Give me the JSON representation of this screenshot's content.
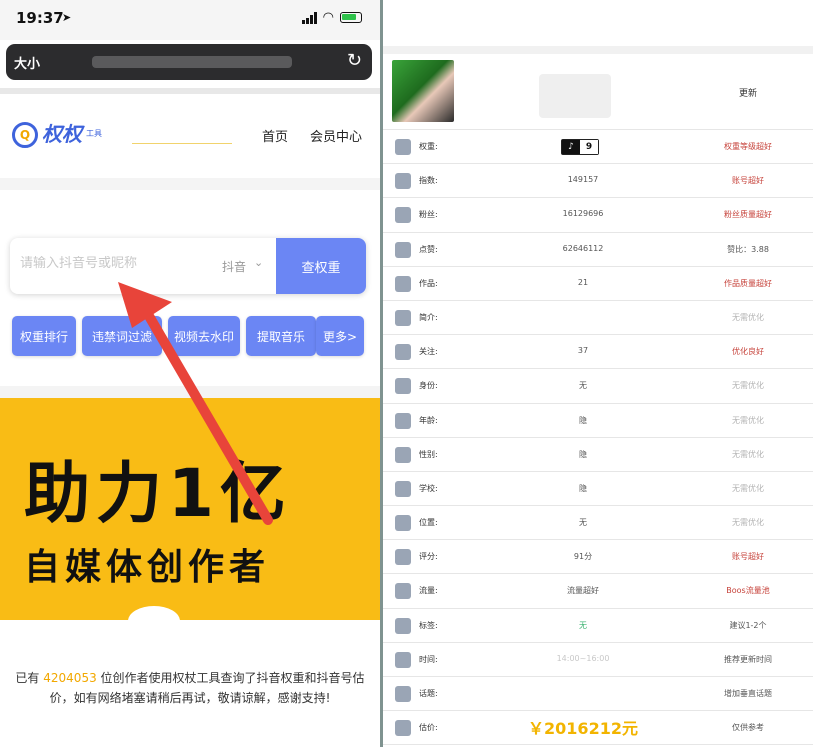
{
  "status_bar": {
    "time": "19:37",
    "location_icon": "location-arrow-icon"
  },
  "url_bar": {
    "text_size": "大小",
    "reload_icon": "reload-icon"
  },
  "site": {
    "logo_mark": "Q",
    "logo_text": "权权",
    "logo_sub": "工具",
    "nav": {
      "home": "首页",
      "member": "会员中心"
    }
  },
  "search": {
    "placeholder": "请输入抖音号或昵称",
    "platform": "抖音",
    "button": "查权重"
  },
  "quick_buttons": [
    "权重排行",
    "违禁词过滤",
    "视频去水印",
    "提取音乐",
    "更多>"
  ],
  "banner": {
    "line1": "助力1亿",
    "line2": "自媒体创作者"
  },
  "notice": {
    "prefix": "已有",
    "count": "4204053",
    "suffix": "位创作者使用权杖工具查询了抖音权重和抖音号估价，如有网络堵塞请稍后再试，敬请谅解，感谢支持!"
  },
  "profile": {
    "update_label": "更新"
  },
  "stats": [
    {
      "label": "权重:",
      "value": "",
      "badge_num": "9",
      "note": "权重等级超好",
      "note_color": "red",
      "icon": "weight-icon"
    },
    {
      "label": "指数:",
      "value": "149157",
      "note": "账号超好",
      "note_color": "red",
      "icon": "index-icon"
    },
    {
      "label": "粉丝:",
      "value": "16129696",
      "note": "粉丝质量超好",
      "note_color": "red",
      "icon": "fans-icon"
    },
    {
      "label": "点赞:",
      "value": "62646112",
      "note": "赞比：3.88",
      "note_color": "dark",
      "icon": "like-icon"
    },
    {
      "label": "作品:",
      "value": "21",
      "note": "作品质量超好",
      "note_color": "red",
      "icon": "works-icon"
    },
    {
      "label": "简介:",
      "value": "",
      "note": "无需优化",
      "note_color": "gray",
      "icon": "intro-icon"
    },
    {
      "label": "关注:",
      "value": "37",
      "note": "优化良好",
      "note_color": "red",
      "icon": "follow-icon"
    },
    {
      "label": "身份:",
      "value": "无",
      "note": "无需优化",
      "note_color": "gray",
      "icon": "identity-icon"
    },
    {
      "label": "年龄:",
      "value": "隐",
      "note": "无需优化",
      "note_color": "gray",
      "icon": "age-icon"
    },
    {
      "label": "性别:",
      "value": "隐",
      "note": "无需优化",
      "note_color": "gray",
      "icon": "gender-icon"
    },
    {
      "label": "学校:",
      "value": "隐",
      "note": "无需优化",
      "note_color": "gray",
      "icon": "school-icon"
    },
    {
      "label": "位置:",
      "value": "无",
      "note": "无需优化",
      "note_color": "gray",
      "icon": "location-icon"
    },
    {
      "label": "评分:",
      "value": "91分",
      "note": "账号超好",
      "note_color": "red",
      "icon": "score-icon"
    },
    {
      "label": "流量:",
      "value": "流量超好",
      "note": "Boos流量池",
      "note_color": "red",
      "icon": "traffic-icon"
    },
    {
      "label": "标签:",
      "value": "无",
      "value_color": "green",
      "note": "建议1-2个",
      "note_color": "dark",
      "icon": "tag-icon"
    },
    {
      "label": "时间:",
      "value": "14:00~16:00",
      "value_color": "lightgray",
      "note": "推荐更新时间",
      "note_color": "dark",
      "icon": "time-icon"
    },
    {
      "label": "话题:",
      "value": "",
      "note": "增加垂直话题",
      "note_color": "dark",
      "icon": "topic-icon"
    },
    {
      "label": "估价:",
      "value": "￥2016212元",
      "big": true,
      "note": "仅供参考",
      "note_color": "dark",
      "icon": "valuation-icon"
    }
  ],
  "colors": {
    "accent": "#6b86f4",
    "banner": "#f9bc15",
    "arrow": "#e8443a",
    "red_note": "#c6423a",
    "price": "#f2b400"
  }
}
